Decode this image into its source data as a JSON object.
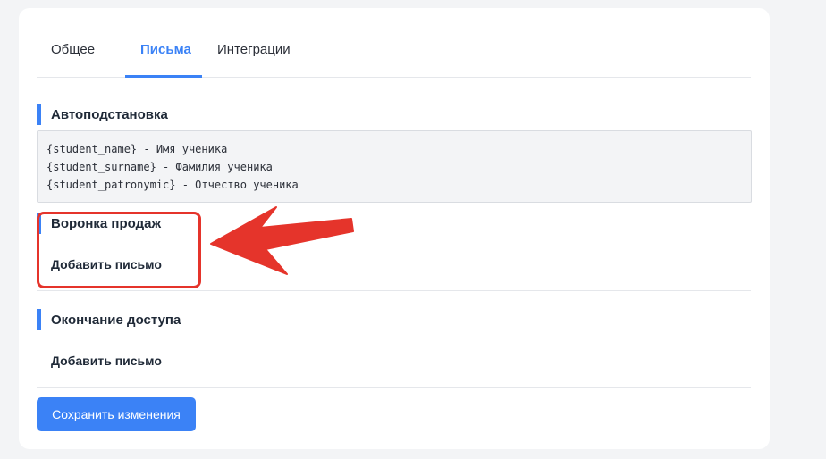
{
  "tabs": [
    {
      "label": "Общее",
      "active": false
    },
    {
      "label": "Письма",
      "active": true
    },
    {
      "label": "Интеграции",
      "active": false
    }
  ],
  "autosubstitution": {
    "title": "Автоподстановка",
    "lines": [
      "{student_name} - Имя ученика",
      "{student_surname} - Фамилия ученика",
      "{student_patronymic} - Отчество ученика"
    ]
  },
  "sales_funnel": {
    "title": "Воронка продаж",
    "add_label": "Добавить письмо"
  },
  "access_end": {
    "title": "Окончание доступа",
    "add_label": "Добавить письмо"
  },
  "save_label": "Сохранить изменения",
  "colors": {
    "accent": "#3b82f6",
    "annotation": "#e5342b"
  },
  "annotation": {
    "arrow_icon": "arrow-left-icon"
  }
}
